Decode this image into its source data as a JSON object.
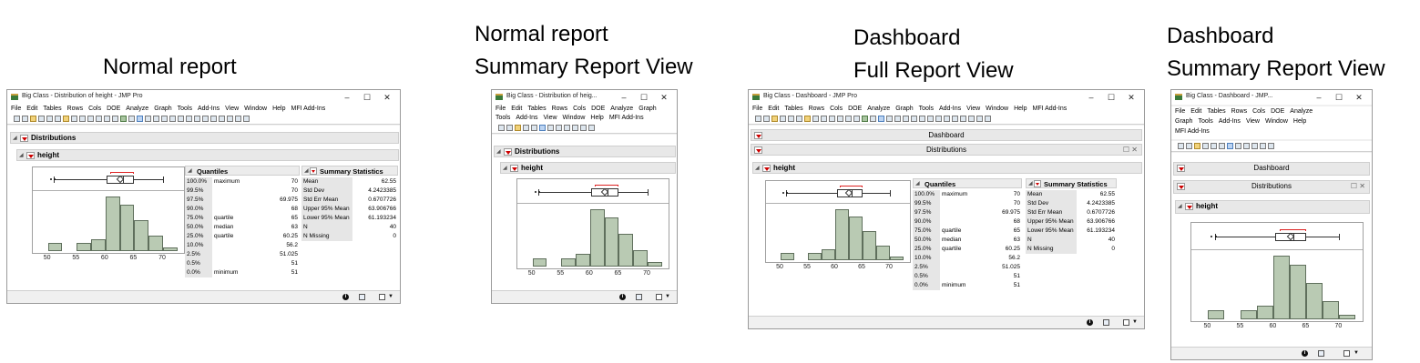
{
  "captions": {
    "c1": "Normal report",
    "c2a": "Normal report",
    "c2b": "Summary Report View",
    "c3a": "Dashboard",
    "c3b": "Full Report View",
    "c4a": "Dashboard",
    "c4b": "Summary Report View"
  },
  "windows": {
    "w1_title": "Big Class - Distribution of height - JMP Pro",
    "w2_title": "Big Class - Distribution of heig...",
    "w3_title": "Big Class - Dashboard - JMP Pro",
    "w4_title": "Big Class - Dashboard - JMP...",
    "controls": {
      "min": "–",
      "max": "☐",
      "close": "✕"
    }
  },
  "menus": {
    "w1": [
      "File",
      "Edit",
      "Tables",
      "Rows",
      "Cols",
      "DOE",
      "Analyze",
      "Graph",
      "Tools",
      "Add-Ins",
      "View",
      "Window",
      "Help",
      "MFI Add-Ins"
    ],
    "w2_r1": [
      "File",
      "Edit",
      "Tables",
      "Rows",
      "Cols",
      "DOE",
      "Analyze",
      "Graph"
    ],
    "w2_r2": [
      "Tools",
      "Add-Ins",
      "View",
      "Window",
      "Help",
      "MFI Add-Ins"
    ],
    "w3": [
      "File",
      "Edit",
      "Tables",
      "Rows",
      "Cols",
      "DOE",
      "Analyze",
      "Graph",
      "Tools",
      "Add-Ins",
      "View",
      "Window",
      "Help",
      "MFI Add-Ins"
    ],
    "w4_r1": [
      "File",
      "Edit",
      "Tables",
      "Rows",
      "Cols",
      "DOE",
      "Analyze"
    ],
    "w4_r2": [
      "Graph",
      "Tools",
      "Add-Ins",
      "View",
      "Window",
      "Help"
    ],
    "w4_r3": [
      "MFI Add-Ins"
    ]
  },
  "outline": {
    "distributions": "Distributions",
    "height": "height",
    "dashboard": "Dashboard"
  },
  "quantiles": {
    "title": "Quantiles",
    "rows": [
      {
        "pct": "100.0%",
        "name": "maximum",
        "value": "70"
      },
      {
        "pct": "99.5%",
        "name": "",
        "value": "70"
      },
      {
        "pct": "97.5%",
        "name": "",
        "value": "69.975"
      },
      {
        "pct": "90.0%",
        "name": "",
        "value": "68"
      },
      {
        "pct": "75.0%",
        "name": "quartile",
        "value": "65"
      },
      {
        "pct": "50.0%",
        "name": "median",
        "value": "63"
      },
      {
        "pct": "25.0%",
        "name": "quartile",
        "value": "60.25"
      },
      {
        "pct": "10.0%",
        "name": "",
        "value": "56.2"
      },
      {
        "pct": "2.5%",
        "name": "",
        "value": "51.025"
      },
      {
        "pct": "0.5%",
        "name": "",
        "value": "51"
      },
      {
        "pct": "0.0%",
        "name": "minimum",
        "value": "51"
      }
    ]
  },
  "summary": {
    "title": "Summary Statistics",
    "rows": [
      {
        "name": "Mean",
        "value": "62.55"
      },
      {
        "name": "Std Dev",
        "value": "4.2423385"
      },
      {
        "name": "Std Err Mean",
        "value": "0.6707726"
      },
      {
        "name": "Upper 95% Mean",
        "value": "63.906766"
      },
      {
        "name": "Lower 95% Mean",
        "value": "61.193234"
      },
      {
        "name": "N",
        "value": "40"
      },
      {
        "name": "N Missing",
        "value": "0"
      }
    ]
  },
  "chart_data": {
    "type": "bar",
    "title": "",
    "xlabel": "",
    "ylabel": "",
    "bins": [
      [
        50,
        52.5
      ],
      [
        52.5,
        55
      ],
      [
        55,
        57.5
      ],
      [
        57.5,
        60
      ],
      [
        60,
        62.5
      ],
      [
        62.5,
        65
      ],
      [
        65,
        67.5
      ],
      [
        67.5,
        70
      ],
      [
        70,
        72.5
      ]
    ],
    "values": [
      2,
      0,
      2,
      3,
      14,
      12,
      8,
      4,
      1
    ],
    "xlim": [
      48,
      73
    ],
    "xticks": [
      "50",
      "55",
      "60",
      "65",
      "70"
    ],
    "boxplot": {
      "min": 51,
      "q1": 60.25,
      "median": 63,
      "q3": 65,
      "max": 70,
      "mean": 62.55,
      "outliers": [
        50.5,
        51.2
      ]
    }
  }
}
